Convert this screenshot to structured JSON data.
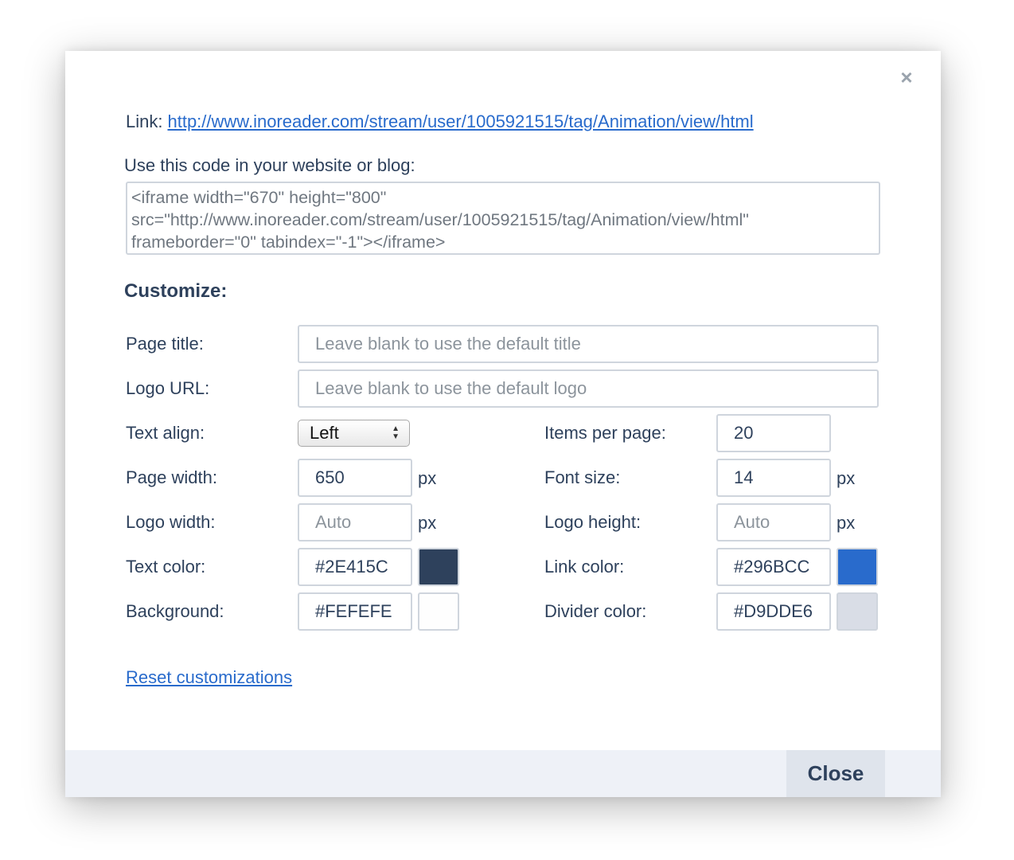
{
  "dialog": {
    "close_glyph": "×",
    "link_label": "Link:",
    "link_url": "http://www.inoreader.com/stream/user/1005921515/tag/Animation/view/html",
    "code_label": "Use this code in your website or blog:",
    "code_value": "<iframe width=\"670\" height=\"800\"\nsrc=\"http://www.inoreader.com/stream/user/1005921515/tag/Animation/view/html\"\nframeborder=\"0\" tabindex=\"-1\"></iframe>",
    "customize_heading": "Customize:"
  },
  "form": {
    "page_title": {
      "label": "Page title:",
      "placeholder": "Leave blank to use the default title",
      "value": ""
    },
    "logo_url": {
      "label": "Logo URL:",
      "placeholder": "Leave blank to use the default logo",
      "value": ""
    },
    "text_align": {
      "label": "Text align:",
      "value": "Left"
    },
    "items_per_page": {
      "label": "Items per page:",
      "value": "20"
    },
    "page_width": {
      "label": "Page width:",
      "value": "650",
      "unit": "px"
    },
    "font_size": {
      "label": "Font size:",
      "value": "14",
      "unit": "px"
    },
    "logo_width": {
      "label": "Logo width:",
      "placeholder": "Auto",
      "value": "",
      "unit": "px"
    },
    "logo_height": {
      "label": "Logo height:",
      "placeholder": "Auto",
      "value": "",
      "unit": "px"
    },
    "text_color": {
      "label": "Text color:",
      "value": "#2E415C",
      "swatch": "#2E415C"
    },
    "link_color": {
      "label": "Link color:",
      "value": "#296BCC",
      "swatch": "#296BCC"
    },
    "background": {
      "label": "Background:",
      "value": "#FEFEFE",
      "swatch": "#FEFEFE"
    },
    "divider_color": {
      "label": "Divider color:",
      "value": "#D9DDE6",
      "swatch": "#D9DDE6"
    }
  },
  "reset_link": "Reset customizations",
  "footer": {
    "close_label": "Close"
  }
}
